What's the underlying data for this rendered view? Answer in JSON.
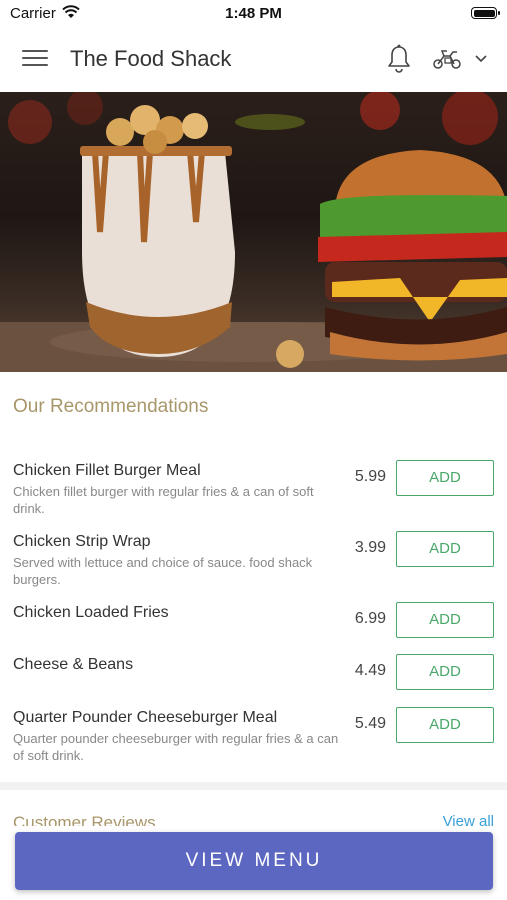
{
  "status_bar": {
    "carrier": "Carrier",
    "time": "1:48 PM"
  },
  "header": {
    "title": "The Food Shack"
  },
  "icons": {
    "menu": "hamburger-icon",
    "bell": "bell-icon",
    "delivery": "scooter-icon",
    "dropdown": "chevron-down-icon"
  },
  "recommendations": {
    "title": "Our Recommendations",
    "items": [
      {
        "name": "Chicken Fillet Burger Meal",
        "description": "Chicken fillet burger with regular fries & a can of soft drink.",
        "price": "5.99",
        "action": "ADD"
      },
      {
        "name": "Chicken Strip Wrap",
        "description": "Served with lettuce and choice of sauce. food shack burgers.",
        "price": "3.99",
        "action": "ADD"
      },
      {
        "name": "Chicken Loaded Fries",
        "description": "",
        "price": "6.99",
        "action": "ADD"
      },
      {
        "name": "Cheese & Beans",
        "description": "",
        "price": "4.49",
        "action": "ADD"
      },
      {
        "name": "Quarter Pounder Cheeseburger Meal",
        "description": "Quarter pounder cheeseburger with regular fries & a can of soft drink.",
        "price": "5.49",
        "action": "ADD"
      }
    ]
  },
  "reviews": {
    "title": "Customer Reviews",
    "view_all": "View all"
  },
  "cta": {
    "label": "VIEW MENU"
  },
  "colors": {
    "accent_green": "#4aa76a",
    "section_title": "#a8976a",
    "cta_bg": "#5c67c2",
    "link": "#3aa0d8"
  }
}
